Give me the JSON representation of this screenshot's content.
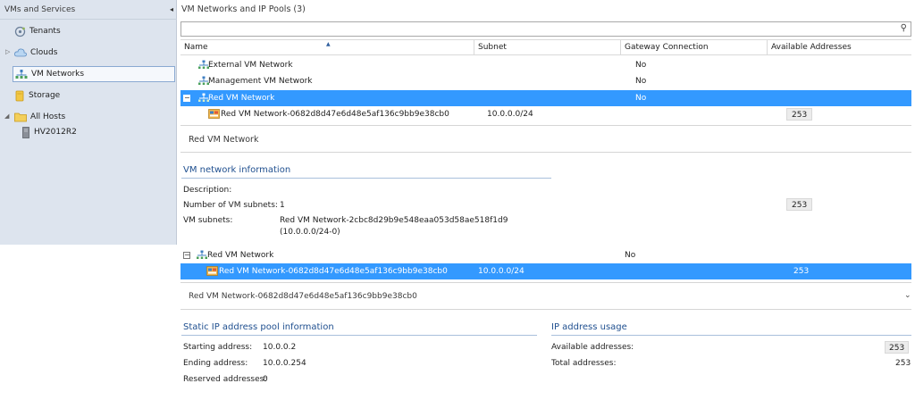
{
  "nav": {
    "header": "VMs and Services",
    "collapse_glyph": "◂",
    "items": [
      {
        "label": "Tenants",
        "icon": "tenants-icon"
      },
      {
        "label": "Clouds",
        "icon": "cloud-icon"
      },
      {
        "label": "VM Networks",
        "icon": "vm-network-icon"
      },
      {
        "label": "Storage",
        "icon": "storage-icon"
      },
      {
        "label": "All Hosts",
        "icon": "folder-icon"
      },
      {
        "label": "HV2012R2",
        "icon": "host-icon"
      }
    ]
  },
  "main": {
    "title": "VM Networks and IP Pools (3)",
    "search": {
      "value": "",
      "placeholder": ""
    },
    "columns": [
      "Name",
      "Subnet",
      "Gateway Connection",
      "Available Addresses"
    ],
    "rows": [
      {
        "name": "External VM Network",
        "subnet": "",
        "gateway": "No",
        "available": ""
      },
      {
        "name": "Management VM Network",
        "subnet": "",
        "gateway": "No",
        "available": ""
      },
      {
        "name": "Red VM Network",
        "subnet": "",
        "gateway": "No",
        "available": ""
      },
      {
        "name": "Red VM Network-0682d8d47e6d48e5af136c9bb9e38cb0",
        "subnet": "10.0.0.0/24",
        "gateway": "",
        "available": "253"
      }
    ]
  },
  "detail": {
    "title": "Red VM Network",
    "section_title": "VM network information",
    "description_label": "Description:",
    "description_value": "",
    "num_subnets_label": "Number of VM subnets:",
    "num_subnets_value": "1",
    "vm_subnets_label": "VM subnets:",
    "vm_subnets_value_line1": "Red VM Network-2cbc8d29b9e548eaa053d58ae518f1d9",
    "vm_subnets_value_line2": "(10.0.0.0/24-0)",
    "side_badge": "253",
    "tree": {
      "parent_name": "Red VM Network",
      "parent_gateway": "No",
      "child_name": "Red VM Network-0682d8d47e6d48e5af136c9bb9e38cb0",
      "child_subnet": "10.0.0.0/24",
      "child_available": "253"
    }
  },
  "pool": {
    "header": "Red VM Network-0682d8d47e6d48e5af136c9bb9e38cb0",
    "static_title": "Static IP address pool information",
    "starting_label": "Starting address:",
    "starting_value": "10.0.0.2",
    "ending_label": "Ending address:",
    "ending_value": "10.0.0.254",
    "reserved_label": "Reserved addresses:",
    "reserved_value": "0",
    "usage_title": "IP address usage",
    "available_label": "Available addresses:",
    "available_value": "253",
    "total_label": "Total addresses:",
    "total_value": "253"
  },
  "colors": {
    "selection": "#3399ff",
    "nav_background": "#dde4ee",
    "section_title": "#1f4f8f"
  }
}
